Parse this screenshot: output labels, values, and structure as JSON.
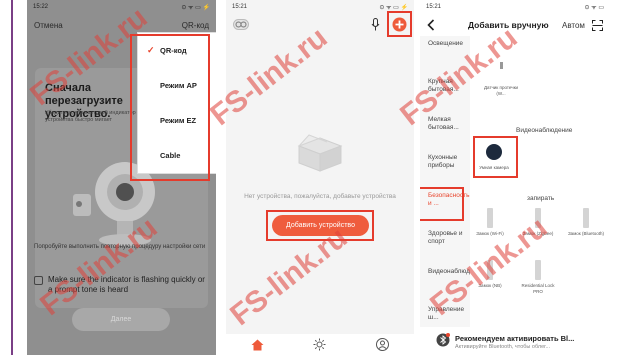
{
  "colors": {
    "accent": "#e8452d",
    "highlight_box": "#e53b2c",
    "watermark_red": "#e0423a",
    "watermark_blue": "#5fa8d8"
  },
  "screen1": {
    "status_time": "15:22",
    "status_icons": "⊙ ᯤ ▭ ⚡",
    "cancel_label": "Отмена",
    "qr_label": "QR-код",
    "heading": "Сначала перезагрузите устройство.",
    "hint": "Убедитесь, что световой индикатор устройства быстро мигает",
    "reset_text": "Попробуйте выполнить повторную процедуру настройки сети",
    "checkbox_label": "Make sure the indicator is flashing quickly or a prompt tone is heard",
    "next_button": "Далее",
    "menu": [
      {
        "label": "QR-код",
        "selected": true
      },
      {
        "label": "Режим AP",
        "selected": false
      },
      {
        "label": "Режим EZ",
        "selected": false
      },
      {
        "label": "Cable",
        "selected": false
      }
    ]
  },
  "screen2": {
    "status_time": "15:21",
    "status_icons": "⊙ ᯤ ▭ ⚡",
    "empty_text": "Нет устройства, пожалуйста, добавьте устройства",
    "add_button": "Добавить устройство",
    "tabs": [
      "home-icon",
      "sun-icon",
      "profile-icon"
    ]
  },
  "screen3": {
    "status_time": "15:21",
    "status_icons": "⊙ ᯤ ▭",
    "title": "Добавить вручную",
    "auto_label": "Автом",
    "categories": [
      {
        "label": "Освещение",
        "active": false
      },
      {
        "label": "Крупная бытовая...",
        "active": false
      },
      {
        "label": "Мелкая бытовая...",
        "active": false
      },
      {
        "label": "Кухонные приборы",
        "active": false
      },
      {
        "label": "Безопасность и ...",
        "active": true
      },
      {
        "label": "Здоровье и спорт",
        "active": false
      },
      {
        "label": "Видеонаблюдение",
        "active": false
      },
      {
        "label": "Управление ш...",
        "active": false
      }
    ],
    "top_item": "Датчик протечки (W...",
    "video_section": "Видеонаблюдение",
    "camera_item": "Умная камера",
    "lock_section": "запирать",
    "locks": [
      {
        "label": "Замок (Wi-Fi)"
      },
      {
        "label": "Замок (Zigbee)"
      },
      {
        "label": "Замок (Bluetooth)"
      },
      {
        "label": "Замок (NB)"
      },
      {
        "label": "Residential Lock PRO"
      }
    ],
    "banner_title": "Рекомендуем активировать Bl...",
    "banner_sub": "Активируйте Bluetooth, чтобы облег..."
  },
  "watermark": "FS-link.ru"
}
